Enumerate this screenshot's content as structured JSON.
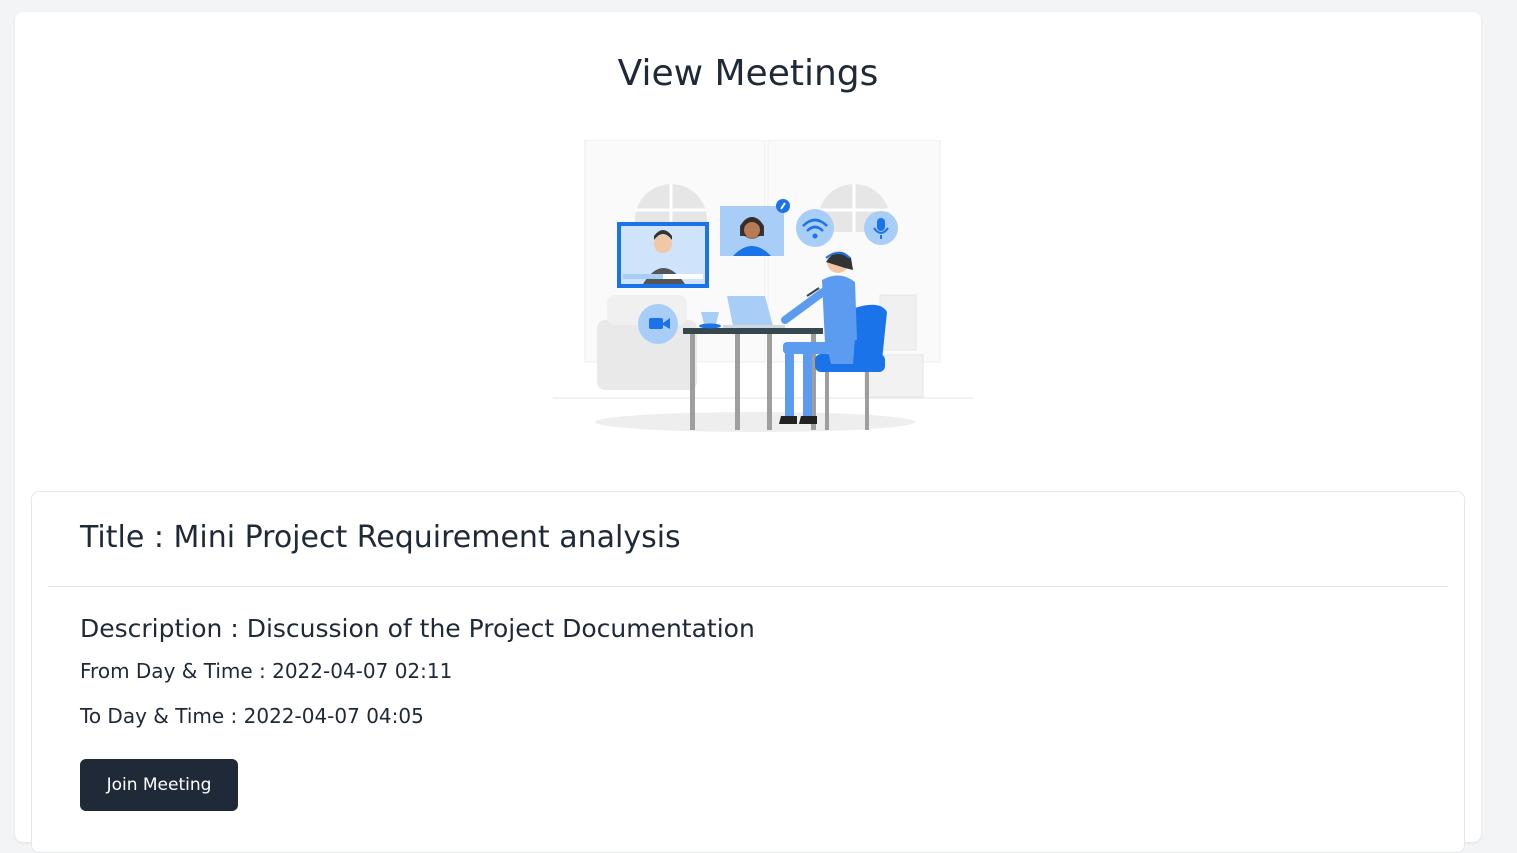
{
  "page": {
    "title": "View Meetings"
  },
  "illustration": {
    "icon_names": [
      "video-camera-icon",
      "wifi-icon",
      "microphone-icon",
      "pin-icon",
      "coffee-cup-icon",
      "laptop-icon"
    ]
  },
  "meeting": {
    "title": "Title : Mini Project Requirement analysis",
    "description": "Description : Discussion of the Project Documentation",
    "from": "From Day & Time : 2022-04-07 02:11",
    "to": "To Day & Time : 2022-04-07 04:05",
    "join_label": "Join Meeting"
  },
  "colors": {
    "accent": "#1f2937",
    "illustration_blue": "#1a73e8",
    "illustration_light_blue": "#a8cdf7"
  }
}
